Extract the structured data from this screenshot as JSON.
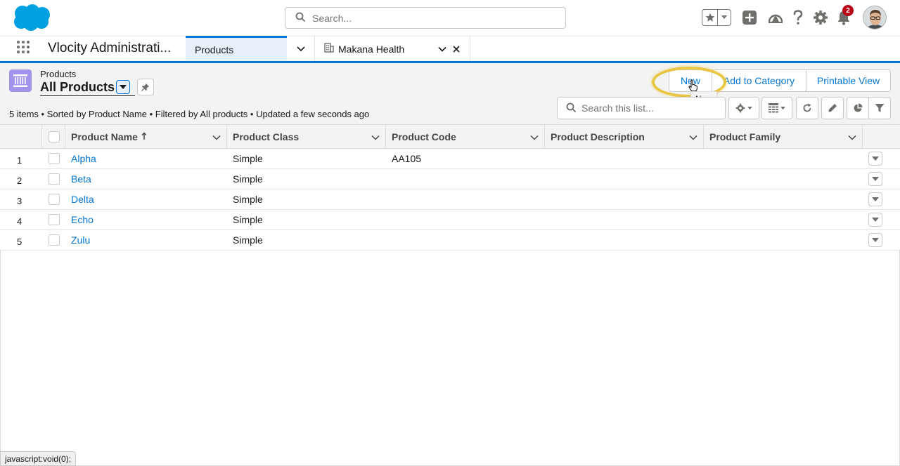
{
  "header": {
    "search_placeholder": "Search...",
    "notification_count": "2"
  },
  "nav": {
    "app_name": "Vlocity Administrati...",
    "tabs": [
      {
        "label": "Products",
        "active": true
      },
      {
        "label": "Makana Health",
        "active": false
      }
    ]
  },
  "list_view": {
    "object_label": "Products",
    "title": "All Products",
    "meta": "5 items • Sorted by Product Name • Filtered by All products • Updated a few seconds ago",
    "buttons": {
      "new": "New",
      "add_to_category": "Add to Category",
      "printable_view": "Printable View"
    },
    "tooltip": "New",
    "search_placeholder": "Search this list..."
  },
  "table": {
    "columns": [
      {
        "label": "Product Name",
        "sorted": "asc"
      },
      {
        "label": "Product Class"
      },
      {
        "label": "Product Code"
      },
      {
        "label": "Product Description"
      },
      {
        "label": "Product Family"
      }
    ],
    "rows": [
      {
        "num": "1",
        "name": "Alpha",
        "class": "Simple",
        "code": "AA105",
        "description": "",
        "family": ""
      },
      {
        "num": "2",
        "name": "Beta",
        "class": "Simple",
        "code": "",
        "description": "",
        "family": ""
      },
      {
        "num": "3",
        "name": "Delta",
        "class": "Simple",
        "code": "",
        "description": "",
        "family": ""
      },
      {
        "num": "4",
        "name": "Echo",
        "class": "Simple",
        "code": "",
        "description": "",
        "family": ""
      },
      {
        "num": "5",
        "name": "Zulu",
        "class": "Simple",
        "code": "",
        "description": "",
        "family": ""
      }
    ]
  },
  "status_bar": "javascript:void(0);",
  "colors": {
    "brand": "#0176d3",
    "object_icon": "#a094ed",
    "highlight": "#e8c644",
    "badge": "#ba0517"
  },
  "icons": [
    "salesforce-cloud-logo",
    "search-icon",
    "star-icon",
    "plus-icon",
    "trailhead-icon",
    "help-icon",
    "gear-icon",
    "bell-icon",
    "app-launcher-icon",
    "building-icon",
    "pin-icon",
    "refresh-icon",
    "pencil-icon",
    "chart-icon",
    "filter-icon",
    "table-icon"
  ]
}
